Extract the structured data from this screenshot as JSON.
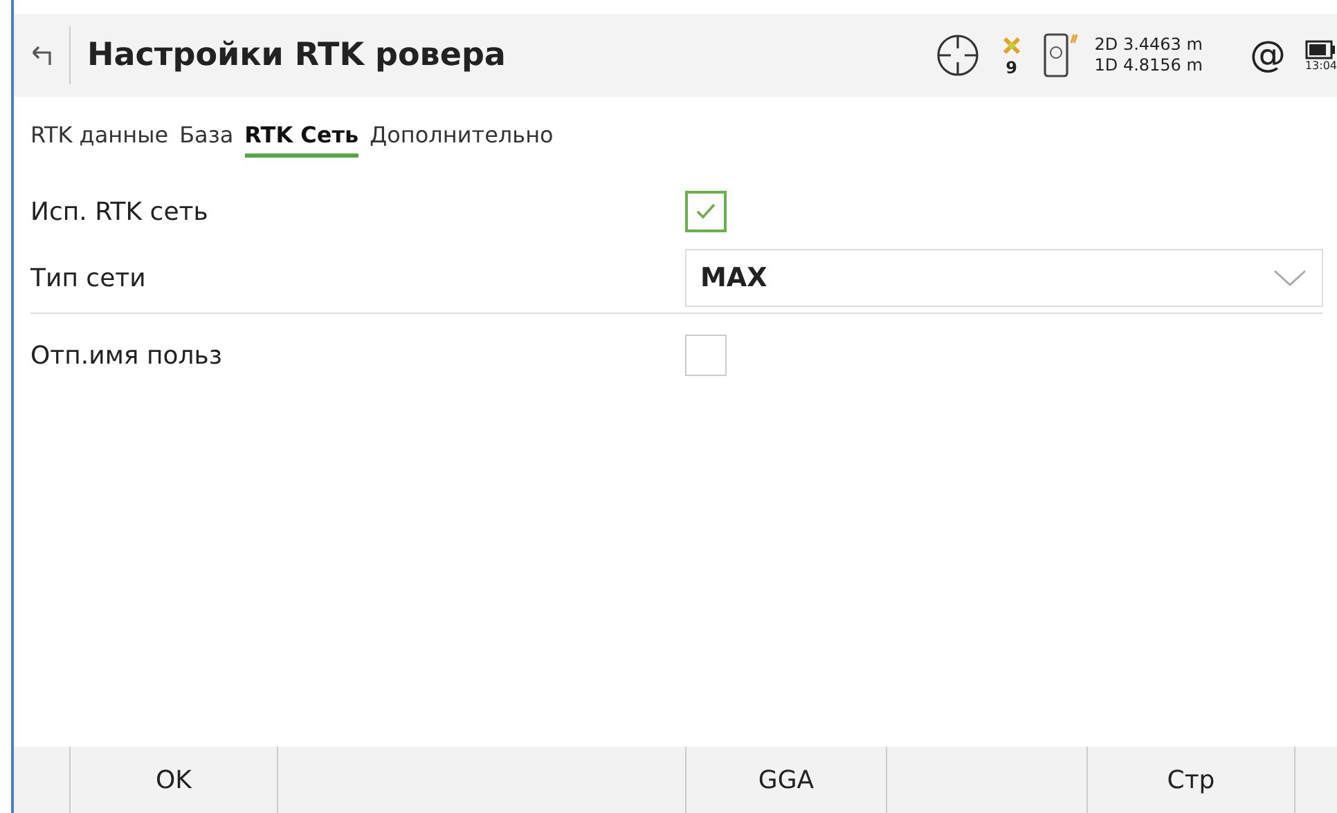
{
  "header": {
    "title": "Настройки RTK ровера",
    "satellites": "9",
    "precision_2d": "2D 3.4463 m",
    "precision_1d": "1D 4.8156 m",
    "at_sign": "@",
    "time": "13:04"
  },
  "tabs": [
    {
      "label": "RTK данные",
      "selected": false
    },
    {
      "label": "База",
      "selected": false
    },
    {
      "label": "RTK Сеть",
      "selected": true
    },
    {
      "label": "Дополнительно",
      "selected": false
    }
  ],
  "fields": [
    {
      "kind": "checkbox",
      "label": "Исп.  RTK сеть",
      "checked": true
    },
    {
      "kind": "dropdown",
      "label": "Тип сети",
      "value": "MAX"
    },
    {
      "kind": "checkbox",
      "label": "Отп.имя польз",
      "checked": false
    }
  ],
  "softkeys": [
    {
      "kind": "button",
      "label": "OK"
    },
    {
      "kind": "blank"
    },
    {
      "kind": "button",
      "label": "GGA"
    },
    {
      "kind": "blank"
    },
    {
      "kind": "button",
      "label": "Стр"
    },
    {
      "kind": "blank"
    }
  ]
}
